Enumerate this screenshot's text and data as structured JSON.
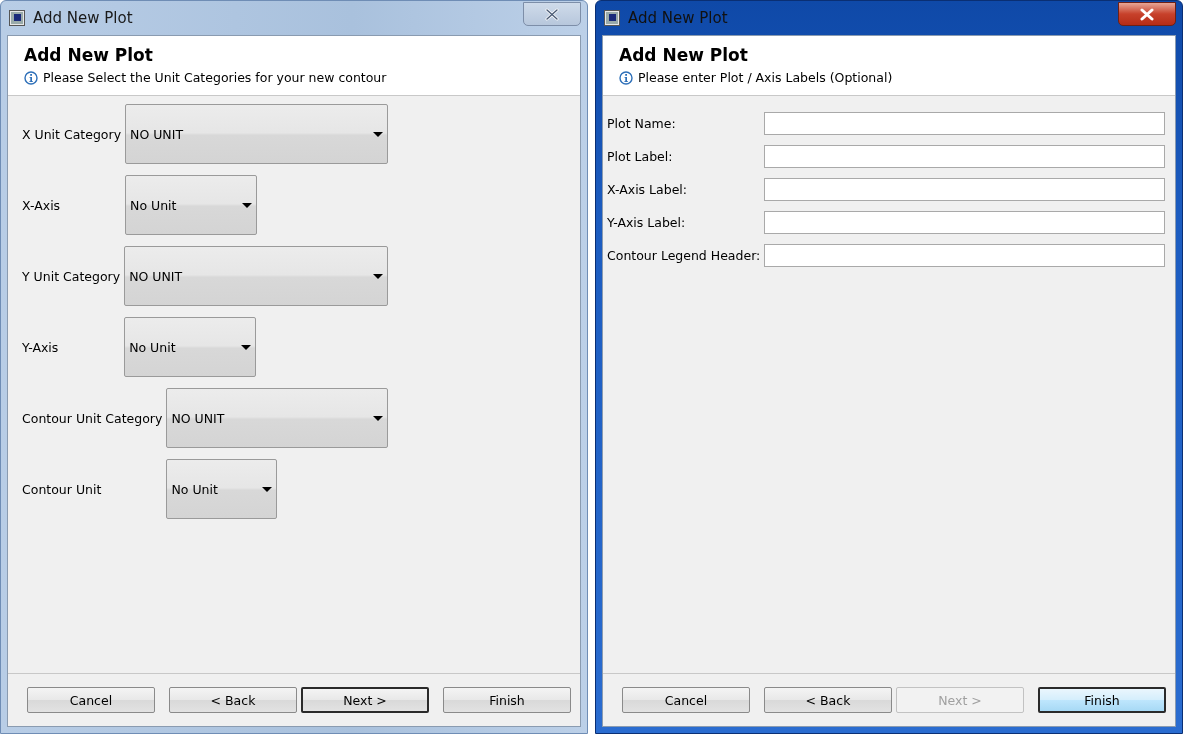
{
  "windows": [
    {
      "title": "Add New Plot",
      "active": false,
      "heading": "Add New Plot",
      "subtitle": "Please Select the Unit Categories for your new contour",
      "kind": "units",
      "groups": [
        {
          "category": {
            "label": "X Unit Category",
            "value": "NO UNIT"
          },
          "unit": {
            "label": "X-Axis",
            "value": "No Unit"
          }
        },
        {
          "category": {
            "label": "Y Unit Category",
            "value": "NO UNIT"
          },
          "unit": {
            "label": "Y-Axis",
            "value": "No Unit"
          }
        },
        {
          "category": {
            "label": "Contour Unit Category",
            "value": "NO UNIT"
          },
          "unit": {
            "label": "Contour Unit",
            "value": "No Unit"
          }
        }
      ],
      "buttons": [
        {
          "label": "Cancel",
          "disabled": false,
          "focused": false
        },
        {
          "label": "< Back",
          "disabled": false,
          "focused": false
        },
        {
          "label": "Next >",
          "disabled": false,
          "focused": true
        },
        {
          "label": "Finish",
          "disabled": false,
          "focused": false
        }
      ]
    },
    {
      "title": "Add New Plot",
      "active": true,
      "heading": "Add New Plot",
      "subtitle": "Please enter Plot / Axis Labels (Optional)",
      "kind": "labels",
      "fields": [
        {
          "label": "Plot Name:"
        },
        {
          "label": "Plot Label:"
        },
        {
          "label": "X-Axis Label:"
        },
        {
          "label": "Y-Axis Label:"
        },
        {
          "label": "Contour Legend Header:"
        }
      ],
      "buttons": [
        {
          "label": "Cancel",
          "disabled": false,
          "focused": false
        },
        {
          "label": "< Back",
          "disabled": false,
          "focused": false
        },
        {
          "label": "Next >",
          "disabled": true,
          "focused": false
        },
        {
          "label": "Finish",
          "disabled": false,
          "focused": true
        }
      ]
    }
  ]
}
